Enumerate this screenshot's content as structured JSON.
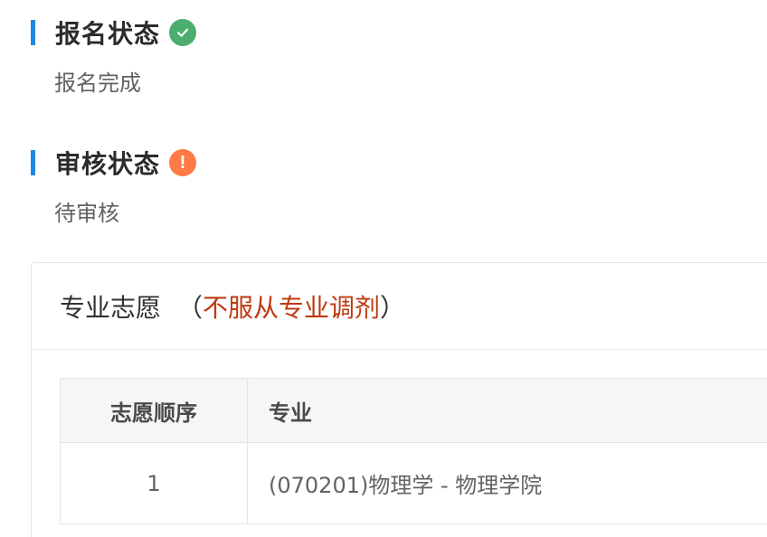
{
  "registration_status": {
    "title": "报名状态",
    "status_icon": "check-circle-icon",
    "icon_color": "#4cae6e",
    "value": "报名完成"
  },
  "review_status": {
    "title": "审核状态",
    "status_icon": "exclamation-circle-icon",
    "icon_color": "#ff7a45",
    "icon_glyph": "!",
    "value": "待审核"
  },
  "major_preferences": {
    "title": "专业志愿",
    "paren_open": "（",
    "note": "不服从专业调剂",
    "paren_close": "）",
    "note_color": "#c0390f",
    "table": {
      "columns": [
        "志愿顺序",
        "专业"
      ],
      "rows": [
        {
          "order": "1",
          "major": "(070201)物理学 - 物理学院"
        }
      ]
    }
  },
  "accent_color": "#1e88e5"
}
